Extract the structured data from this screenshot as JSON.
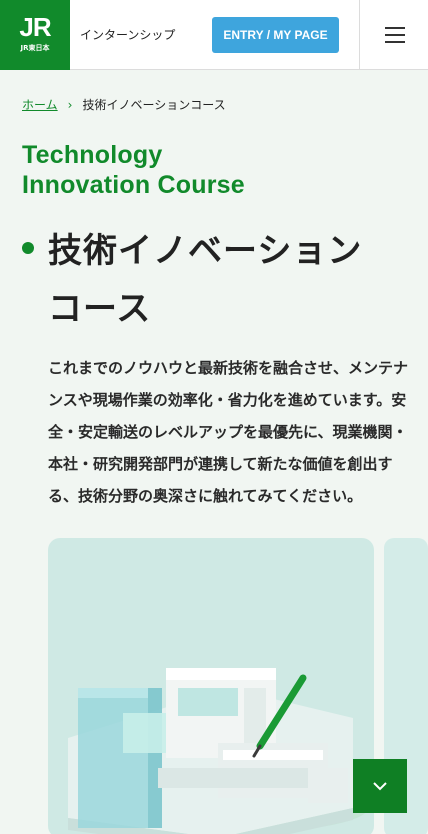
{
  "header": {
    "logo_text": "JR",
    "logo_sub": "JR東日本",
    "title": "インターンシップ",
    "entry_label": "ENTRY / MY PAGE"
  },
  "breadcrumb": {
    "home": "ホーム",
    "current": "技術イノベーションコース"
  },
  "page": {
    "title_en_line1": "Technology",
    "title_en_line2": "Innovation Course",
    "title_jp_line1": "技術イノベーション",
    "title_jp_line2": "コース",
    "description": "これまでのノウハウと最新技術を融合させ、メンテナンスや現場作業の効率化・省力化を進めています。安全・安定輸送のレベルアップを最優先に、現業機関・本社・研究開発部門が連携して新たな価値を創出する、技術分野の奥深さに触れてみてください。"
  },
  "colors": {
    "brand_green": "#118a2b",
    "entry_blue": "#3ea5dd",
    "background": "#f1f6f2"
  },
  "icons": {
    "menu": "hamburger-icon",
    "breadcrumb_sep": "chevron-right-icon",
    "scroll": "chevron-down-icon"
  }
}
